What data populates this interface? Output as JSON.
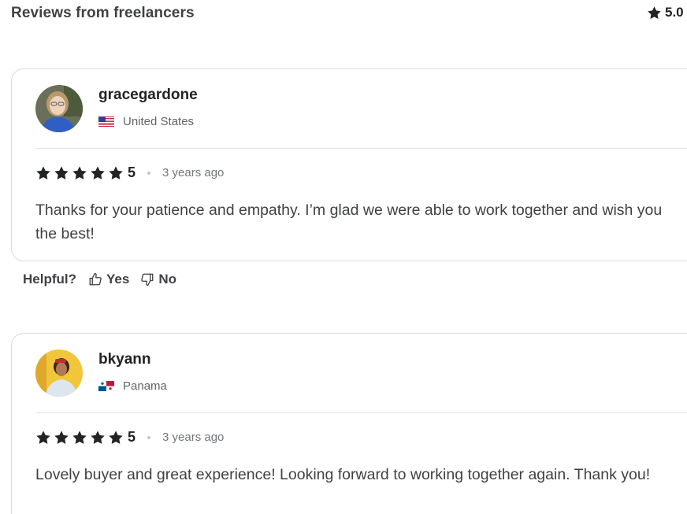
{
  "header": {
    "title": "Reviews from freelancers",
    "overall_rating": "5.0",
    "star_icon": "star-icon"
  },
  "reviews": [
    {
      "username": "gracegardone",
      "country": "United States",
      "flag_icon": "us-flag-icon",
      "rating": "5",
      "stars": 5,
      "time_ago": "3 years ago",
      "text": "Thanks for your patience and empathy. I’m glad we were able to work together and wish you the best!"
    },
    {
      "username": "bkyann",
      "country": "Panama",
      "flag_icon": "panama-flag-icon",
      "rating": "5",
      "stars": 5,
      "time_ago": "3 years ago",
      "text": "Lovely buyer and great experience! Looking forward to working together again. Thank you!"
    }
  ],
  "helpful": {
    "label": "Helpful?",
    "yes_label": "Yes",
    "no_label": "No"
  },
  "colors": {
    "text": "#404145",
    "dark_text": "#222325",
    "muted": "#74767e",
    "border": "#dadbdd"
  }
}
